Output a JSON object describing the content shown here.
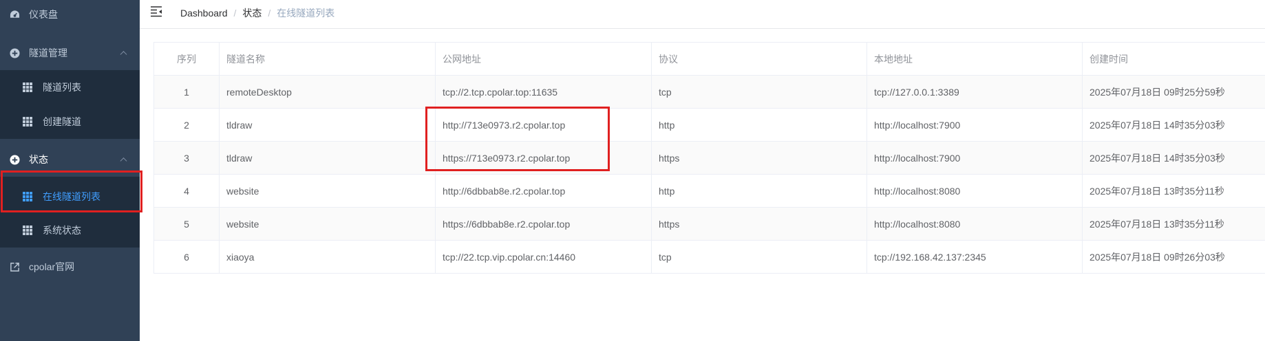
{
  "sidebar": {
    "dashboard": {
      "label": "仪表盘",
      "icon": "dashboard-icon"
    },
    "tunnel_group": {
      "label": "隧道管理",
      "icon": "plus-circle-icon",
      "items": [
        {
          "label": "隧道列表",
          "icon": "table-icon"
        },
        {
          "label": "创建隧道",
          "icon": "table-icon"
        }
      ]
    },
    "status_group": {
      "label": "状态",
      "icon": "plus-circle-icon",
      "items": [
        {
          "label": "在线隧道列表",
          "icon": "table-icon",
          "active": true
        },
        {
          "label": "系统状态",
          "icon": "table-icon"
        }
      ]
    },
    "website": {
      "label": "cpolar官网",
      "icon": "external-link-icon"
    }
  },
  "header": {
    "breadcrumb": [
      "Dashboard",
      "状态",
      "在线隧道列表"
    ],
    "separator": "/"
  },
  "table": {
    "columns": [
      "序列",
      "隧道名称",
      "公网地址",
      "协议",
      "本地地址",
      "创建时间"
    ],
    "rows": [
      [
        "1",
        "remoteDesktop",
        "tcp://2.tcp.cpolar.top:11635",
        "tcp",
        "tcp://127.0.0.1:3389",
        "2025年07月18日 09时25分59秒"
      ],
      [
        "2",
        "tldraw",
        "http://713e0973.r2.cpolar.top",
        "http",
        "http://localhost:7900",
        "2025年07月18日 14时35分03秒"
      ],
      [
        "3",
        "tldraw",
        "https://713e0973.r2.cpolar.top",
        "https",
        "http://localhost:7900",
        "2025年07月18日 14时35分03秒"
      ],
      [
        "4",
        "website",
        "http://6dbbab8e.r2.cpolar.top",
        "http",
        "http://localhost:8080",
        "2025年07月18日 13时35分11秒"
      ],
      [
        "5",
        "website",
        "https://6dbbab8e.r2.cpolar.top",
        "https",
        "http://localhost:8080",
        "2025年07月18日 13时35分11秒"
      ],
      [
        "6",
        "xiaoya",
        "tcp://22.tcp.vip.cpolar.cn:14460",
        "tcp",
        "tcp://192.168.42.137:2345",
        "2025年07月18日 09时26分03秒"
      ]
    ]
  },
  "colors": {
    "sidebar_bg": "#304156",
    "submenu_bg": "#1f2d3d",
    "menu_text": "#bfcbd9",
    "active_text": "#409eff",
    "highlight_border": "#e02020"
  }
}
